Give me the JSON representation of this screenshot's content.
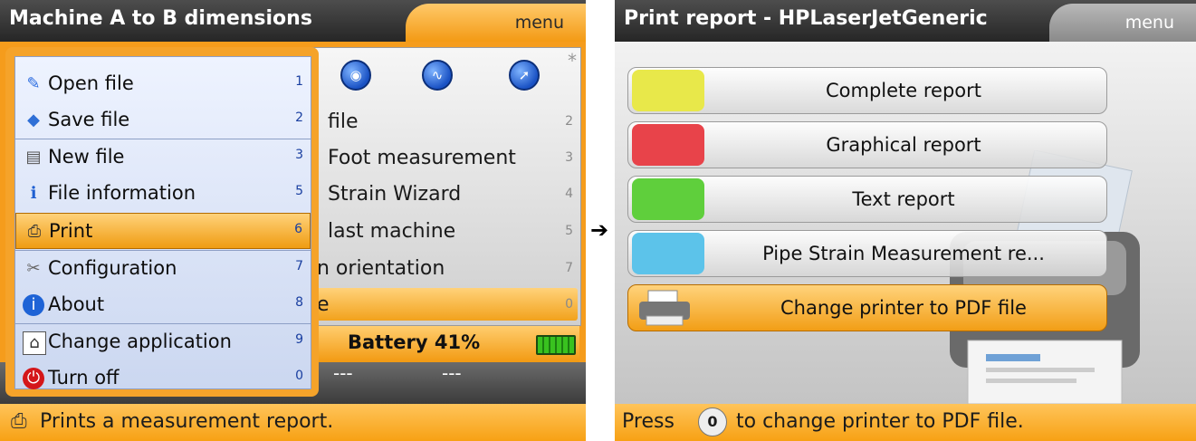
{
  "left": {
    "title": "Machine A to B dimensions",
    "menu_label": "menu",
    "background_rows": [
      {
        "label": "file",
        "key": "2"
      },
      {
        "label": "Foot measurement",
        "key": "3"
      },
      {
        "label": "Strain Wizard",
        "key": "4"
      },
      {
        "label": "last machine",
        "key": "5"
      },
      {
        "label": "n orientation",
        "key": "7"
      },
      {
        "label": "e",
        "key": "0"
      }
    ],
    "star_glyph": "*",
    "battery_text": "Battery 41%",
    "battery_level": 0.41,
    "dashes": [
      "---",
      "---"
    ],
    "popup": {
      "items": [
        {
          "icon": "open-file-icon",
          "label": "Open file",
          "key": "1"
        },
        {
          "icon": "save-file-icon",
          "label": "Save file",
          "key": "2"
        },
        {
          "icon": "new-file-icon",
          "label": "New file",
          "key": "3"
        },
        {
          "icon": "file-information-icon",
          "label": "File information",
          "key": "5"
        },
        {
          "icon": "print-icon",
          "label": "Print",
          "key": "6",
          "selected": true
        },
        {
          "icon": "configuration-icon",
          "label": "Configuration",
          "key": "7"
        },
        {
          "icon": "about-icon",
          "label": "About",
          "key": "8"
        },
        {
          "icon": "change-application-icon",
          "label": "Change application",
          "key": "9"
        },
        {
          "icon": "turn-off-icon",
          "label": "Turn off",
          "key": "0"
        }
      ]
    },
    "status": "Prints a measurement report."
  },
  "arrow": "➔",
  "right": {
    "title": "Print report - HPLaserJetGeneric",
    "menu_label": "menu",
    "buttons": [
      {
        "label": "Complete report",
        "icon": "complete-report-icon",
        "color": "#e8e84a"
      },
      {
        "label": "Graphical report",
        "icon": "graphical-report-icon",
        "color": "#e8434a"
      },
      {
        "label": "Text report",
        "icon": "text-report-icon",
        "color": "#5fcf3c"
      },
      {
        "label": "Pipe Strain Measurement re...",
        "icon": "pipe-strain-report-icon",
        "color": "#5cc3ea"
      },
      {
        "label": "Change printer to PDF file",
        "icon": "printer-icon",
        "color": "#f29e16",
        "selected": true
      }
    ],
    "status_before": "Press",
    "status_key": "0",
    "status_after": "to change printer to PDF file."
  },
  "colors": {
    "accent_orange": "#f59c1c",
    "title_bar": "#333333",
    "selection": "#f2a21c"
  }
}
